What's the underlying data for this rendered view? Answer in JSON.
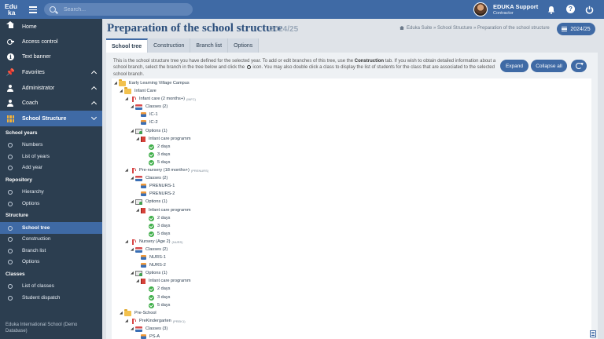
{
  "app": {
    "logo_line1": "Edu",
    "logo_line2": "ka",
    "search_placeholder": "Search..."
  },
  "user": {
    "name": "EDUKA Support",
    "role": "Contractor"
  },
  "sidebar": {
    "items": [
      {
        "label": "Home",
        "icon": "home-icon"
      },
      {
        "label": "Access control",
        "icon": "key-icon"
      },
      {
        "label": "Text banner",
        "icon": "info-icon"
      },
      {
        "label": "Favorites",
        "icon": "pin-icon"
      },
      {
        "label": "Administrator",
        "icon": "user-admin-icon"
      },
      {
        "label": "Coach",
        "icon": "user-coach-icon"
      },
      {
        "label": "School Structure",
        "icon": "structure-icon"
      }
    ],
    "sections": {
      "school_years": "School years",
      "repository": "Repository",
      "structure": "Structure",
      "classes": "Classes"
    },
    "sub": {
      "numbers": "Numbers",
      "list_of_years": "List of years",
      "add_year": "Add year",
      "hierarchy": "Hierarchy",
      "options_repo": "Options",
      "school_tree": "School tree",
      "construction": "Construction",
      "branch_list": "Branch list",
      "options_struct": "Options",
      "list_of_classes": "List of classes",
      "student_dispatch": "Student dispatch"
    },
    "footer": "Eduka International School (Demo Database)"
  },
  "header": {
    "title": "Preparation of the school structure",
    "year": "2024/25",
    "breadcrumb": "Eduka Suite » School Structure » Preparation of the school structure",
    "year_button": "2024/25"
  },
  "tabs": [
    "School tree",
    "Construction",
    "Branch list",
    "Options"
  ],
  "info": {
    "part1": "This is the school structure tree you have defined for the selected year. To add or edit branches of this tree, use the ",
    "bold": "Construction",
    "part2": " tab. If you wish to obtain detailed information about a school branch, select the branch in the tree below and click the ",
    "part3": " icon. You may also double click a class to display the list of students for the class that are associated to the selected school branch."
  },
  "buttons": {
    "expand": "Expand",
    "collapse_all": "Collapse all"
  },
  "tree": {
    "campus": "Early Learning Village Campus",
    "infant_care": "Infant Care",
    "infant_care_2m": "Infant care (2 months+)",
    "infant_care_2m_code": "(INFC)",
    "classes_2": "Classes (2)",
    "ic1": "IC-1",
    "ic2": "IC-2",
    "options_1": "Options (1)",
    "infant_care_programm": "Infant care programm",
    "d2": "2 days",
    "d3": "3 days",
    "d5": "5 days",
    "prenursery": "Pre-nursery (18 months+)",
    "prenursery_code": "(PRENURS)",
    "prenurs1": "PRENURS-1",
    "prenurs2": "PRENURS-2",
    "nursery": "Nursery (Age 2)",
    "nursery_code": "(NURS)",
    "nurs1": "NURS-1",
    "nurs2": "NURS-2",
    "preschool": "Pre-School",
    "prek": "PreKindergarten",
    "prek_code": "(PREK1)",
    "classes_3": "Classes (3)",
    "psa": "PS-A"
  }
}
